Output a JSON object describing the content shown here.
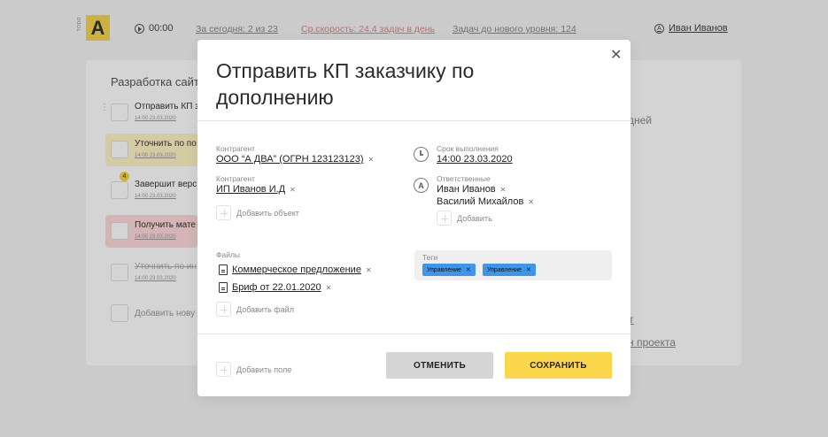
{
  "app": {
    "logo_letter": "A",
    "logo_side": "TODO",
    "timer": "00:00",
    "stats": [
      {
        "label": "За сегодня: 2 из 23",
        "color": "#888888"
      },
      {
        "label": "Ср.скорость: 24.4 задач в день",
        "color": "#dd8888"
      },
      {
        "label": "Задач до нового уровня: 124",
        "color": "#888888"
      }
    ],
    "user_name": "Иван Иванов",
    "project_title": "Разработка сайт",
    "tasks": [
      {
        "title": "Отправить КП з",
        "date": "14:00 23.03.2020",
        "style": "plain"
      },
      {
        "title": "Уточнить по по",
        "date": "14:00 23.03.2020",
        "style": "yellow"
      },
      {
        "title": "Завершит верс",
        "date": "14:00 23.03.2020",
        "style": "plain",
        "badge": "4"
      },
      {
        "title": "Получить мате",
        "date": "14:00 23.03.2020",
        "style": "red"
      },
      {
        "title": "Уточнить по ин",
        "date": "14:00 23.03.2020",
        "style": "done"
      }
    ],
    "add_task_label": "Добавить нову",
    "right_fragments": [
      "дней",
      "т",
      "н проекта"
    ]
  },
  "modal": {
    "title": "Отправить КП заказчику по дополнению",
    "contractor1": {
      "label": "Контрагент",
      "value": "ООО “А ДВА” (ОГРН 123123123)"
    },
    "contractor2": {
      "label": "Контрагент",
      "value": "ИП Иванов И.Д"
    },
    "add_object": "Добавить объект",
    "deadline": {
      "label": "Срок выполнения",
      "value": "14:00 23.03.2020"
    },
    "responsible": {
      "label": "Ответственные",
      "people": [
        "Иван Иванов",
        "Василий Михайлов"
      ],
      "add": "Добавить"
    },
    "files": {
      "label": "Файлы",
      "items": [
        "Коммерческое предложение",
        "Бриф от 22.01.2020"
      ],
      "add": "Добавить файл"
    },
    "tags": {
      "label": "Теги",
      "items": [
        "Управление",
        "Управление"
      ],
      "color": "#3d96eb"
    },
    "add_field": "Добавить поле",
    "cancel": "ОТМЕНИТЬ",
    "save": "СОХРАНИТЬ",
    "colors": {
      "accent": "#f9d64a",
      "cancel_bg": "#d5d5d5"
    }
  }
}
